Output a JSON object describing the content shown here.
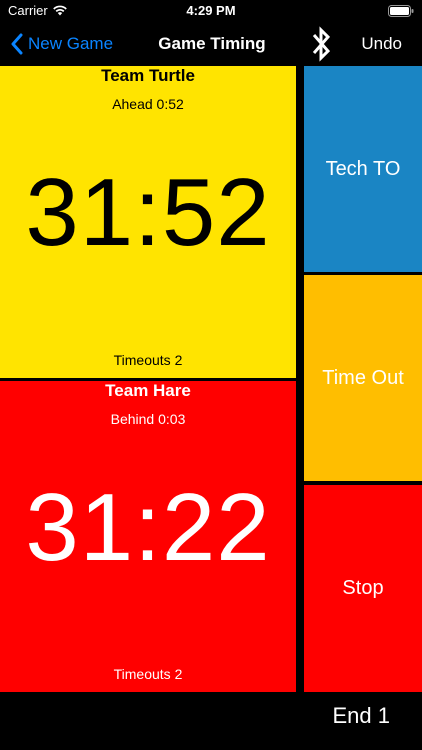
{
  "status_bar": {
    "carrier": "Carrier",
    "time": "4:29 PM"
  },
  "nav": {
    "back_label": "New Game",
    "title": "Game Timing",
    "undo_label": "Undo"
  },
  "teams": [
    {
      "name": "Team Turtle",
      "status": "Ahead  0:52",
      "clock": "31:52",
      "timeouts": "Timeouts 2",
      "color": "#ffe400"
    },
    {
      "name": "Team Hare",
      "status": "Behind  0:03",
      "clock": "31:22",
      "timeouts": "Timeouts 2",
      "color": "#ff0000"
    }
  ],
  "actions": {
    "tech_timeout": "Tech TO",
    "time_out": "Time Out",
    "stop": "Stop"
  },
  "footer": {
    "period": "End 1"
  },
  "colors": {
    "tech_blue": "#1a85c4",
    "timeout_amber": "#ffbe00",
    "stop_red": "#ff0000",
    "link_blue": "#0a84ff"
  }
}
